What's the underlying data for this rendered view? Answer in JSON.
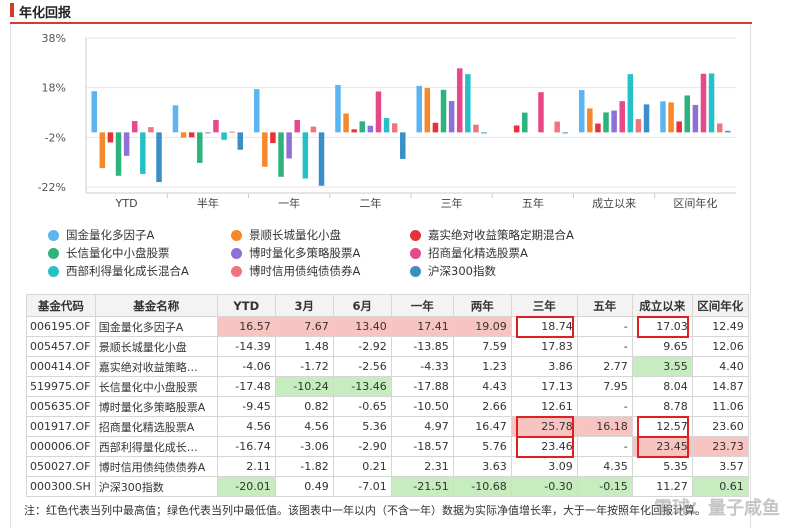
{
  "header": {
    "title": "年化回报"
  },
  "colors": {
    "accent": "#d93a2a",
    "best_cell": "#f8c4c1",
    "worst_cell": "#c6ecbf",
    "highlight_box": "#e02020"
  },
  "legend": [
    {
      "name": "国金量化多因子A",
      "color": "#5bb5f0"
    },
    {
      "name": "景顺长城量化小盘",
      "color": "#f5892a"
    },
    {
      "name": "嘉实绝对收益策略定期混合A",
      "color": "#e8313b"
    },
    {
      "name": "长信量化中小盘股票",
      "color": "#2db37d"
    },
    {
      "name": "博时量化多策略股票A",
      "color": "#8f6fd8"
    },
    {
      "name": "招商量化精选股票A",
      "color": "#e8478c"
    },
    {
      "name": "西部利得量化成长混合A",
      "color": "#25c0c8"
    },
    {
      "name": "博时信用债纯债债券A",
      "color": "#f0737d"
    },
    {
      "name": "沪深300指数",
      "color": "#3a8fc9"
    }
  ],
  "chart_data": {
    "type": "bar",
    "categories": [
      "YTD",
      "半年",
      "一年",
      "二年",
      "三年",
      "五年",
      "成立以来",
      "区间年化"
    ],
    "ylim": [
      -22,
      38
    ],
    "yticks": [
      "38%",
      "18%",
      "-2%",
      "-22%"
    ],
    "grid": true,
    "legend_position": "bottom",
    "series": [
      {
        "name": "国金量化多因子A",
        "values": [
          16.57,
          10.9,
          17.41,
          19.09,
          18.74,
          null,
          17.03,
          12.49
        ]
      },
      {
        "name": "景顺长城量化小盘",
        "values": [
          -14.39,
          -2.1,
          -13.85,
          7.59,
          17.83,
          null,
          9.65,
          12.06
        ]
      },
      {
        "name": "嘉实绝对收益策略定期混合A",
        "values": [
          -4.06,
          -2.0,
          -4.33,
          1.23,
          3.86,
          2.77,
          3.55,
          4.4
        ]
      },
      {
        "name": "长信量化中小盘股票",
        "values": [
          -17.48,
          -12.3,
          -17.88,
          4.43,
          17.13,
          7.95,
          8.04,
          14.87
        ]
      },
      {
        "name": "博时量化多策略股票A",
        "values": [
          -9.45,
          -0.3,
          -10.5,
          2.66,
          12.61,
          null,
          8.78,
          11.06
        ]
      },
      {
        "name": "招商量化精选股票A",
        "values": [
          4.56,
          5.0,
          4.97,
          16.47,
          25.78,
          16.18,
          12.57,
          23.6
        ]
      },
      {
        "name": "西部利得量化成长混合A",
        "values": [
          -16.74,
          -3.0,
          -18.57,
          5.76,
          23.46,
          null,
          23.45,
          23.73
        ]
      },
      {
        "name": "博时信用债纯债债券A",
        "values": [
          2.11,
          0.3,
          2.31,
          3.63,
          3.09,
          4.35,
          5.35,
          3.57
        ]
      },
      {
        "name": "沪深300指数",
        "values": [
          -20.01,
          -7.0,
          -21.51,
          -10.68,
          -0.3,
          -0.15,
          11.27,
          0.61
        ]
      }
    ]
  },
  "table": {
    "headers": [
      "基金代码",
      "基金名称",
      "YTD",
      "3月",
      "6月",
      "一年",
      "两年",
      "三年",
      "五年",
      "成立以来",
      "区间年化"
    ],
    "rows": [
      {
        "code": "006195.OF",
        "name": "国金量化多因子A",
        "cells": [
          "16.57",
          "7.67",
          "13.40",
          "17.41",
          "19.09",
          "18.74",
          "-",
          "17.03",
          "12.49"
        ],
        "hl": [
          "red",
          "red",
          "red",
          "red",
          "red",
          "",
          "",
          "",
          ""
        ]
      },
      {
        "code": "005457.OF",
        "name": "景顺长城量化小盘",
        "cells": [
          "-14.39",
          "1.48",
          "-2.92",
          "-13.85",
          "7.59",
          "17.83",
          "-",
          "9.65",
          "12.06"
        ],
        "hl": [
          "",
          "",
          "",
          "",
          "",
          "",
          "",
          "",
          ""
        ]
      },
      {
        "code": "000414.OF",
        "name": "嘉实绝对收益策略…",
        "cells": [
          "-4.06",
          "-1.72",
          "-2.56",
          "-4.33",
          "1.23",
          "3.86",
          "2.77",
          "3.55",
          "4.40"
        ],
        "hl": [
          "",
          "",
          "",
          "",
          "",
          "",
          "",
          "green",
          ""
        ]
      },
      {
        "code": "519975.OF",
        "name": "长信量化中小盘股票",
        "cells": [
          "-17.48",
          "-10.24",
          "-13.46",
          "-17.88",
          "4.43",
          "17.13",
          "7.95",
          "8.04",
          "14.87"
        ],
        "hl": [
          "",
          "green",
          "green",
          "",
          "",
          "",
          "",
          "",
          ""
        ]
      },
      {
        "code": "005635.OF",
        "name": "博时量化多策略股票A",
        "cells": [
          "-9.45",
          "0.82",
          "-0.65",
          "-10.50",
          "2.66",
          "12.61",
          "-",
          "8.78",
          "11.06"
        ],
        "hl": [
          "",
          "",
          "",
          "",
          "",
          "",
          "",
          "",
          ""
        ]
      },
      {
        "code": "001917.OF",
        "name": "招商量化精选股票A",
        "cells": [
          "4.56",
          "4.56",
          "5.36",
          "4.97",
          "16.47",
          "25.78",
          "16.18",
          "12.57",
          "23.60"
        ],
        "hl": [
          "",
          "",
          "",
          "",
          "",
          "red",
          "red",
          "",
          ""
        ]
      },
      {
        "code": "000006.OF",
        "name": "西部利得量化成长…",
        "cells": [
          "-16.74",
          "-3.06",
          "-2.90",
          "-18.57",
          "5.76",
          "23.46",
          "-",
          "23.45",
          "23.73"
        ],
        "hl": [
          "",
          "",
          "",
          "",
          "",
          "",
          "",
          "red",
          "red"
        ]
      },
      {
        "code": "050027.OF",
        "name": "博时信用债纯债债券A",
        "cells": [
          "2.11",
          "-1.82",
          "0.21",
          "2.31",
          "3.63",
          "3.09",
          "4.35",
          "5.35",
          "3.57"
        ],
        "hl": [
          "",
          "",
          "",
          "",
          "",
          "",
          "",
          "",
          ""
        ]
      },
      {
        "code": "000300.SH",
        "name": "沪深300指数",
        "cells": [
          "-20.01",
          "0.49",
          "-7.01",
          "-21.51",
          "-10.68",
          "-0.30",
          "-0.15",
          "11.27",
          "0.61"
        ],
        "hl": [
          "green",
          "",
          "",
          "green",
          "green",
          "green",
          "green",
          "",
          "green"
        ]
      }
    ]
  },
  "note": "注：红色代表当列中最高值；绿色代表当列中最低值。该图表中一年以内（不含一年）数据为实际净值增长率，大于一年按照年化回报计算。",
  "watermark": "雪球：量子咸鱼"
}
